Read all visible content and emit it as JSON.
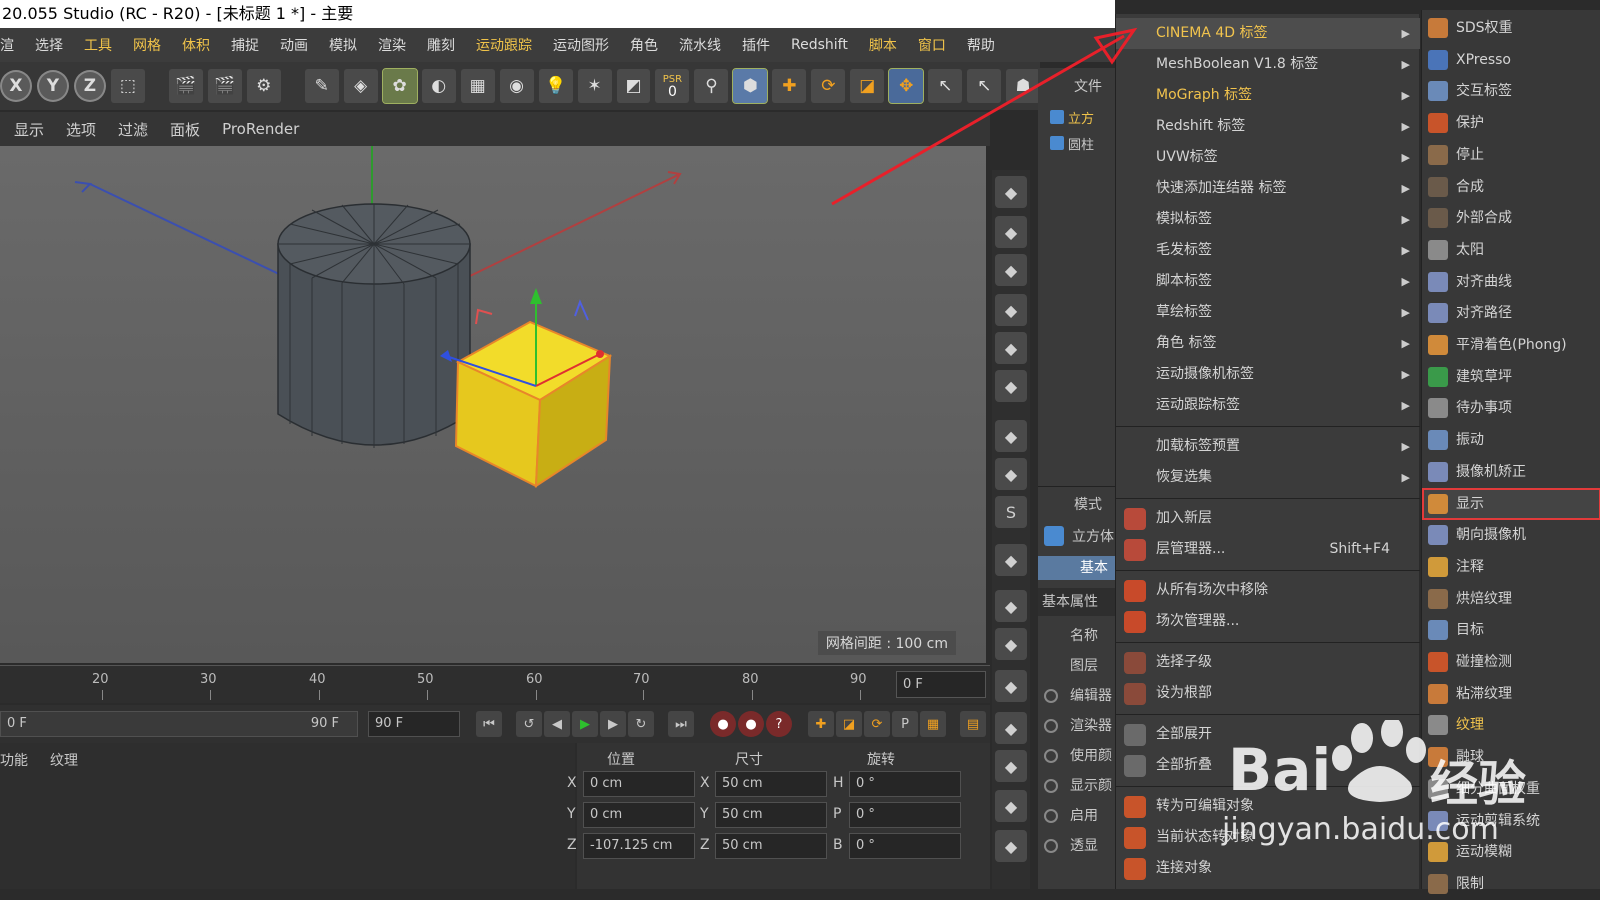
{
  "window": {
    "title": "20.055 Studio (RC - R20) - [未标题 1 *] - 主要"
  },
  "menubar": [
    "渲",
    "选择",
    "工具",
    "网格",
    "体积",
    "捕捉",
    "动画",
    "模拟",
    "渲染",
    "雕刻",
    "运动跟踪",
    "运动图形",
    "角色",
    "流水线",
    "插件",
    "Redshift",
    "脚本",
    "窗口",
    "帮助"
  ],
  "toolbar": {
    "axis_x": "X",
    "axis_y": "Y",
    "axis_z": "Z",
    "psr_label": "PSR",
    "psr_value": "0"
  },
  "viewport_menu": [
    "显示",
    "选项",
    "过滤",
    "面板",
    "ProRender"
  ],
  "viewport": {
    "grid_label": "网格间距 : 100 cm"
  },
  "timeline": {
    "ticks": [
      "20",
      "30",
      "40",
      "50",
      "60",
      "70",
      "80",
      "90"
    ],
    "current_frame": "0 F"
  },
  "transport": {
    "start_field": "0 F",
    "end_slider": "90 F",
    "end_field": "90 F"
  },
  "bottom_tabs": [
    "功能",
    "纹理"
  ],
  "coords": {
    "headers": {
      "position": "位置",
      "size": "尺寸",
      "rotation": "旋转"
    },
    "rows": [
      {
        "axis": "X",
        "pos": "0 cm",
        "size_axis": "X",
        "size": "50 cm",
        "rot_axis": "H",
        "rot": "0 °"
      },
      {
        "axis": "Y",
        "pos": "0 cm",
        "size_axis": "Y",
        "size": "50 cm",
        "rot_axis": "P",
        "rot": "0 °"
      },
      {
        "axis": "Z",
        "pos": "-107.125 cm",
        "size_axis": "Z",
        "size": "50 cm",
        "rot_axis": "B",
        "rot": "0 °"
      }
    ]
  },
  "object_panel": {
    "file_label": "文件",
    "objects": [
      "立方",
      "圆柱"
    ],
    "mode_label": "模式",
    "cube_label": "立方体",
    "basic_tab": "基本",
    "basic_props": "基本属性",
    "props": [
      "名称",
      "图层",
      "编辑器",
      "渲染器",
      "使用颜",
      "显示颜",
      "启用",
      "透显"
    ]
  },
  "context_menu": {
    "items": [
      {
        "label": "CINEMA 4D 标签",
        "arrow": true,
        "state": "highlighted"
      },
      {
        "label": "MeshBoolean V1.8 标签",
        "arrow": true
      },
      {
        "label": "MoGraph 标签",
        "arrow": true,
        "state": "gold"
      },
      {
        "label": "Redshift 标签",
        "arrow": true
      },
      {
        "label": "UVW标签",
        "arrow": true
      },
      {
        "label": "快速添加连结器 标签",
        "arrow": true
      },
      {
        "label": "模拟标签",
        "arrow": true
      },
      {
        "label": "毛发标签",
        "arrow": true
      },
      {
        "label": "脚本标签",
        "arrow": true
      },
      {
        "label": "草绘标签",
        "arrow": true
      },
      {
        "label": "角色 标签",
        "arrow": true
      },
      {
        "label": "运动摄像机标签",
        "arrow": true
      },
      {
        "label": "运动跟踪标签",
        "arrow": true
      }
    ],
    "items2": [
      {
        "label": "加载标签预置",
        "arrow": true
      },
      {
        "label": "恢复选集",
        "arrow": true
      }
    ],
    "items3": [
      {
        "label": "加入新层",
        "icon": "layer-add-icon"
      },
      {
        "label": "层管理器...",
        "shortcut": "Shift+F4",
        "icon": "layer-manager-icon"
      }
    ],
    "items4": [
      {
        "label": "从所有场次中移除",
        "icon": "take-remove-icon"
      },
      {
        "label": "场次管理器...",
        "icon": "take-manager-icon"
      }
    ],
    "items5": [
      {
        "label": "选择子级",
        "icon": "select-children-icon"
      },
      {
        "label": "设为根部",
        "icon": "set-root-icon"
      }
    ],
    "items6": [
      {
        "label": "全部展开",
        "icon": "expand-all-icon"
      },
      {
        "label": "全部折叠",
        "icon": "collapse-all-icon"
      }
    ],
    "items7": [
      {
        "label": "转为可编辑对象",
        "icon": "make-editable-icon"
      },
      {
        "label": "当前状态转对象",
        "icon": "current-state-icon"
      },
      {
        "label": "连接对象",
        "icon": "connect-icon"
      }
    ]
  },
  "submenu": {
    "items": [
      {
        "label": "SDS权重",
        "icon": "sds-weight-icon",
        "color": "#c77a3a"
      },
      {
        "label": "XPresso",
        "icon": "xpresso-icon",
        "color": "#4a74b8"
      },
      {
        "label": "交互标签",
        "icon": "interaction-icon",
        "color": "#6a8ab8"
      },
      {
        "label": "保护",
        "icon": "protection-icon",
        "color": "#c8542a"
      },
      {
        "label": "停止",
        "icon": "stop-icon",
        "color": "#8a6a4a"
      },
      {
        "label": "合成",
        "icon": "compositing-icon",
        "color": "#6a5a4a"
      },
      {
        "label": "外部合成",
        "icon": "external-compositing-icon",
        "color": "#6a5a4a"
      },
      {
        "label": "太阳",
        "icon": "sun-icon",
        "color": "#8a8a8a"
      },
      {
        "label": "对齐曲线",
        "icon": "align-spline-icon",
        "color": "#7a8ab8"
      },
      {
        "label": "对齐路径",
        "icon": "align-path-icon",
        "color": "#7a8ab8"
      },
      {
        "label": "平滑着色(Phong)",
        "icon": "phong-icon",
        "color": "#d08a3a"
      },
      {
        "label": "建筑草坪",
        "icon": "grass-icon",
        "color": "#3a9a4a"
      },
      {
        "label": "待办事项",
        "icon": "todo-icon",
        "color": "#8a8a8a"
      },
      {
        "label": "振动",
        "icon": "vibrate-icon",
        "color": "#6a8ab8"
      },
      {
        "label": "摄像机矫正",
        "icon": "camera-calibrator-icon",
        "color": "#7a8ab8"
      },
      {
        "label": "显示",
        "icon": "display-icon",
        "color": "#d08a3a",
        "state": "selected"
      },
      {
        "label": "朝向摄像机",
        "icon": "look-at-camera-icon",
        "color": "#7a8ab8"
      },
      {
        "label": "注释",
        "icon": "annotation-icon",
        "color": "#d09a3a"
      },
      {
        "label": "烘焙纹理",
        "icon": "bake-texture-icon",
        "color": "#8a6a4a"
      },
      {
        "label": "目标",
        "icon": "target-icon",
        "color": "#6a8ab8"
      },
      {
        "label": "碰撞检测",
        "icon": "collision-icon",
        "color": "#c8542a"
      },
      {
        "label": "粘滞纹理",
        "icon": "sticky-texture-icon",
        "color": "#c87a3a"
      },
      {
        "label": "纹理",
        "icon": "texture-icon",
        "color": "#8a8a8a",
        "state": "gold"
      },
      {
        "label": "融球",
        "icon": "metaball-icon",
        "color": "#c87a3a"
      },
      {
        "label": "细分曲面权重",
        "icon": "weight-icon",
        "color": "#8a8a8a"
      },
      {
        "label": "运动剪辑系统",
        "icon": "motion-system-icon",
        "color": "#7a8ab8"
      },
      {
        "label": "运动模糊",
        "icon": "motion-blur-icon",
        "color": "#d09a3a"
      },
      {
        "label": "限制",
        "icon": "restriction-icon",
        "color": "#8a6a4a"
      }
    ]
  },
  "watermark": {
    "brand": "Bai",
    "brand2": "经验",
    "url": "jingyan.baidu.com"
  },
  "colors": {
    "highlight": "#f1c34d",
    "selection_box": "#e23a3a",
    "cube": "#e6c81e",
    "arrow": "#e8202a"
  }
}
